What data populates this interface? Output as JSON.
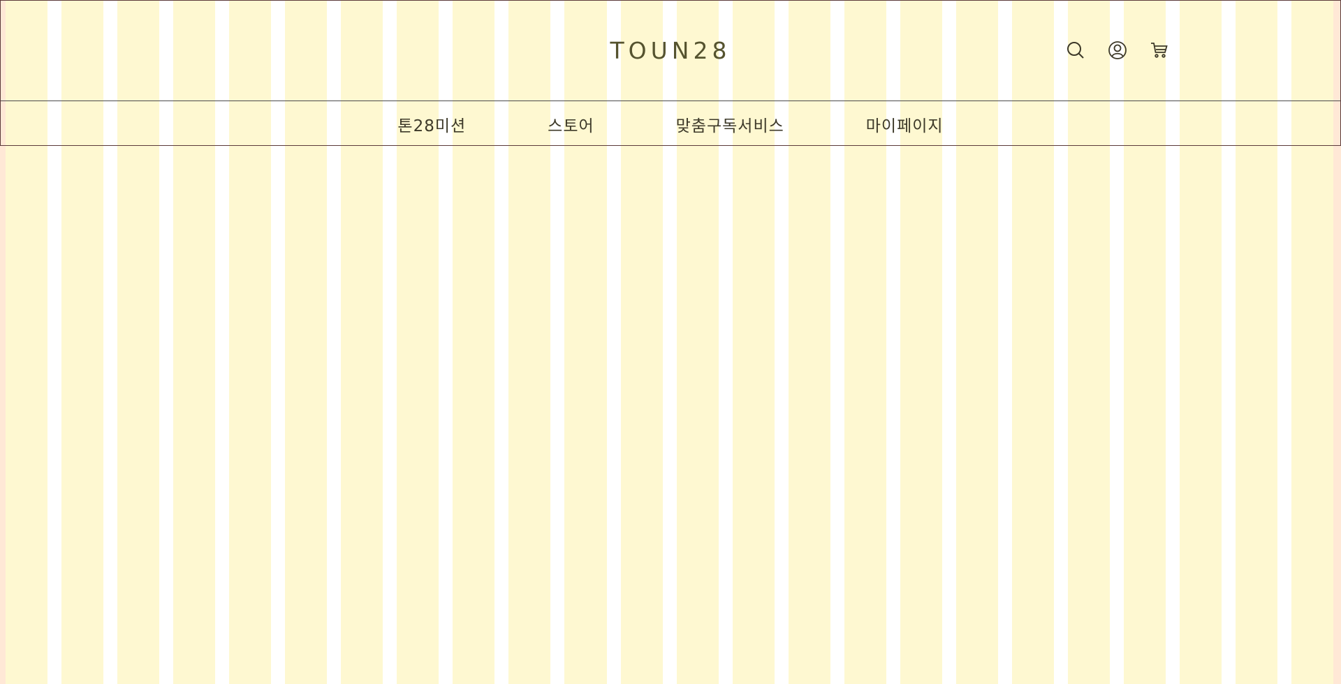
{
  "header": {
    "logo": "TOUN28",
    "utility_icons": [
      "search-icon",
      "user-icon",
      "cart-icon"
    ]
  },
  "nav": {
    "items": [
      {
        "label": "톤28미션"
      },
      {
        "label": "스토어"
      },
      {
        "label": "맞춤구독서비스"
      },
      {
        "label": "마이페이지"
      }
    ]
  },
  "colors": {
    "text": "#3d3929",
    "logo": "#55532f",
    "grid_column": "#fef8d1",
    "grid_gutter": "#ffffff",
    "page_margin": "#ffe8d6"
  }
}
